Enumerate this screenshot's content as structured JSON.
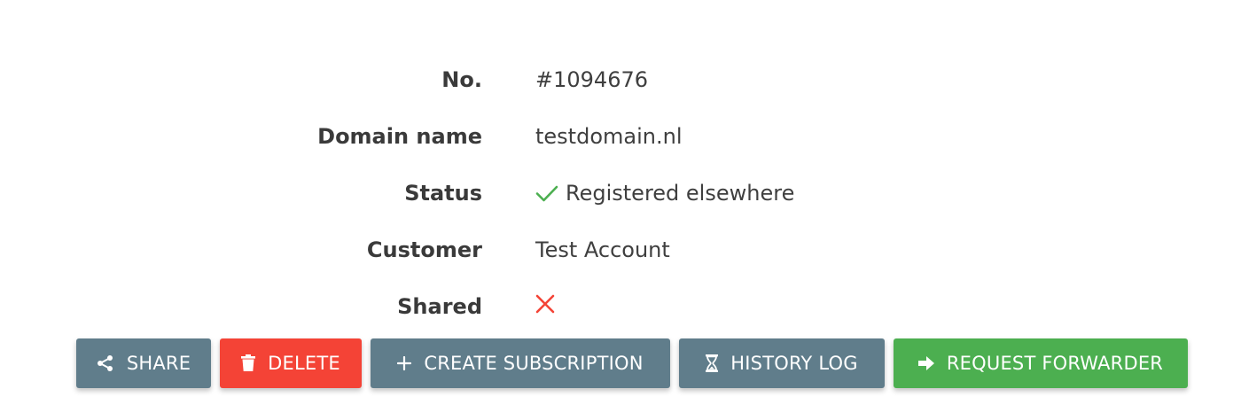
{
  "details": {
    "rows": [
      {
        "label": "No.",
        "value": "#1094676"
      },
      {
        "label": "Domain name",
        "value": "testdomain.nl"
      },
      {
        "label": "Status",
        "value": "Registered elsewhere",
        "icon": "check-icon",
        "icon_color": "#4caf50"
      },
      {
        "label": "Customer",
        "value": "Test Account"
      },
      {
        "label": "Shared",
        "value": "",
        "icon": "cross-icon",
        "icon_color": "#f44336"
      }
    ]
  },
  "actions": {
    "share": {
      "label": "SHARE",
      "icon": "share-icon",
      "color": "#607d8b"
    },
    "delete": {
      "label": "DELETE",
      "icon": "trash-icon",
      "color": "#f44336"
    },
    "create_subscription": {
      "label": "CREATE SUBSCRIPTION",
      "icon": "plus-icon",
      "color": "#607d8b"
    },
    "history_log": {
      "label": "HISTORY LOG",
      "icon": "hourglass-icon",
      "color": "#607d8b"
    },
    "request_forwarder": {
      "label": "REQUEST FORWARDER",
      "icon": "arrow-right-icon",
      "color": "#4caf50"
    }
  }
}
